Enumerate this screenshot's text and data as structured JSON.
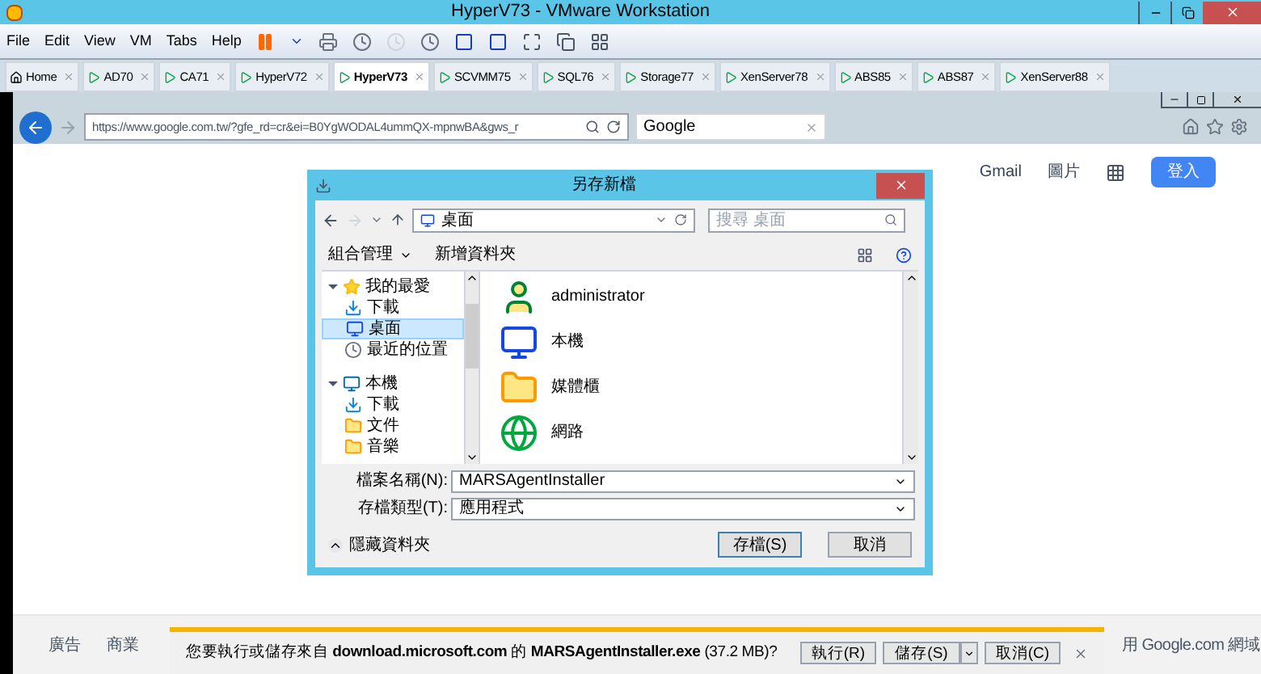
{
  "window": {
    "title": "HyperV73 - VMware Workstation"
  },
  "menu": [
    "File",
    "Edit",
    "View",
    "VM",
    "Tabs",
    "Help"
  ],
  "tabs": [
    {
      "label": "Home",
      "kind": "home",
      "selected": false
    },
    {
      "label": "AD70",
      "kind": "vm",
      "selected": false
    },
    {
      "label": "CA71",
      "kind": "vm",
      "selected": false
    },
    {
      "label": "HyperV72",
      "kind": "vm",
      "selected": false
    },
    {
      "label": "HyperV73",
      "kind": "vm",
      "selected": true
    },
    {
      "label": "SCVMM75",
      "kind": "vm",
      "selected": false
    },
    {
      "label": "SQL76",
      "kind": "vm",
      "selected": false
    },
    {
      "label": "Storage77",
      "kind": "vm",
      "selected": false
    },
    {
      "label": "XenServer78",
      "kind": "vm",
      "selected": false
    },
    {
      "label": "ABS85",
      "kind": "vm",
      "selected": false
    },
    {
      "label": "ABS87",
      "kind": "vm",
      "selected": false
    },
    {
      "label": "XenServer88",
      "kind": "vm",
      "selected": false
    }
  ],
  "browser": {
    "url": "https://www.google.com.tw/?gfe_rd=cr&ei=B0YgWODAL4ummQX-mpnwBA&gws_r",
    "tab": "Google"
  },
  "google": {
    "links": [
      "Gmail",
      "圖片"
    ],
    "signin": "登入",
    "footer_left": [
      "廣告",
      "商業"
    ],
    "footer_right": "用 Google.com 網域"
  },
  "dialog": {
    "title": "另存新檔",
    "path": "桌面",
    "search_placeholder": "搜尋 桌面",
    "toolbar": [
      "組合管理",
      "新增資料夾"
    ],
    "tree": [
      {
        "label": "我的最愛",
        "kind": "star",
        "expanded": true,
        "children": [
          {
            "label": "下載",
            "kind": "download",
            "selected": false
          },
          {
            "label": "桌面",
            "kind": "desktop",
            "selected": true
          },
          {
            "label": "最近的位置",
            "kind": "recent",
            "selected": false
          }
        ]
      },
      {
        "label": "本機",
        "kind": "pc",
        "expanded": true,
        "children": [
          {
            "label": "下載",
            "kind": "download",
            "selected": false
          },
          {
            "label": "文件",
            "kind": "folder",
            "selected": false
          },
          {
            "label": "音樂",
            "kind": "folder",
            "selected": false
          }
        ]
      }
    ],
    "items": [
      {
        "label": "administrator",
        "kind": "user"
      },
      {
        "label": "本機",
        "kind": "pc"
      },
      {
        "label": "媒體櫃",
        "kind": "library"
      },
      {
        "label": "網路",
        "kind": "network"
      }
    ],
    "filename_label": "檔案名稱(N):",
    "filename": "MARSAgentInstaller",
    "type_label": "存檔類型(T):",
    "type": "應用程式",
    "hide_folders": "隱藏資料夾",
    "buttons": [
      "存檔(S)",
      "取消"
    ]
  },
  "download": {
    "prefix": "您要執行或儲存來自 ",
    "host": "download.microsoft.com",
    "mid": " 的 ",
    "file": "MARSAgentInstaller.exe",
    "size": " (37.2 MB)?",
    "buttons": [
      "執行(R)",
      "儲存(S)",
      "取消(C)"
    ]
  }
}
